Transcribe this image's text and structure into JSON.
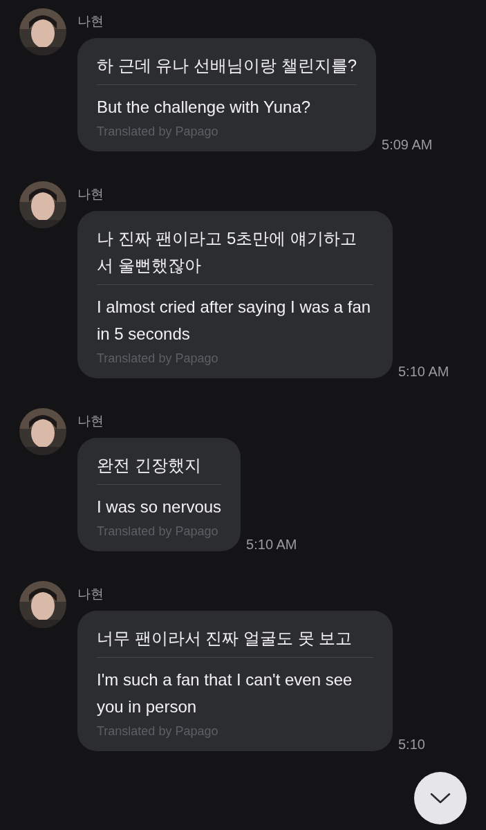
{
  "messages": [
    {
      "sender": "나현",
      "original": "하 근데 유나 선배님이랑 챌린지를?",
      "translation": "But the challenge with Yuna?",
      "credit": "Translated by Papago",
      "time": "5:09 AM"
    },
    {
      "sender": "나현",
      "original": "나 진짜 팬이라고 5초만에 얘기하고서 울뻔했잖아",
      "translation": "I almost cried after saying I was a fan in 5 seconds",
      "credit": "Translated by Papago",
      "time": "5:10 AM"
    },
    {
      "sender": "나현",
      "original": "완전 긴장했지",
      "translation": "I was so nervous",
      "credit": "Translated by Papago",
      "time": "5:10 AM"
    },
    {
      "sender": "나현",
      "original": "너무 팬이라서 진짜 얼굴도 못 보고",
      "translation": "I'm such a fan that I can't even see you in person",
      "credit": "Translated by Papago",
      "time": "5:10"
    }
  ]
}
